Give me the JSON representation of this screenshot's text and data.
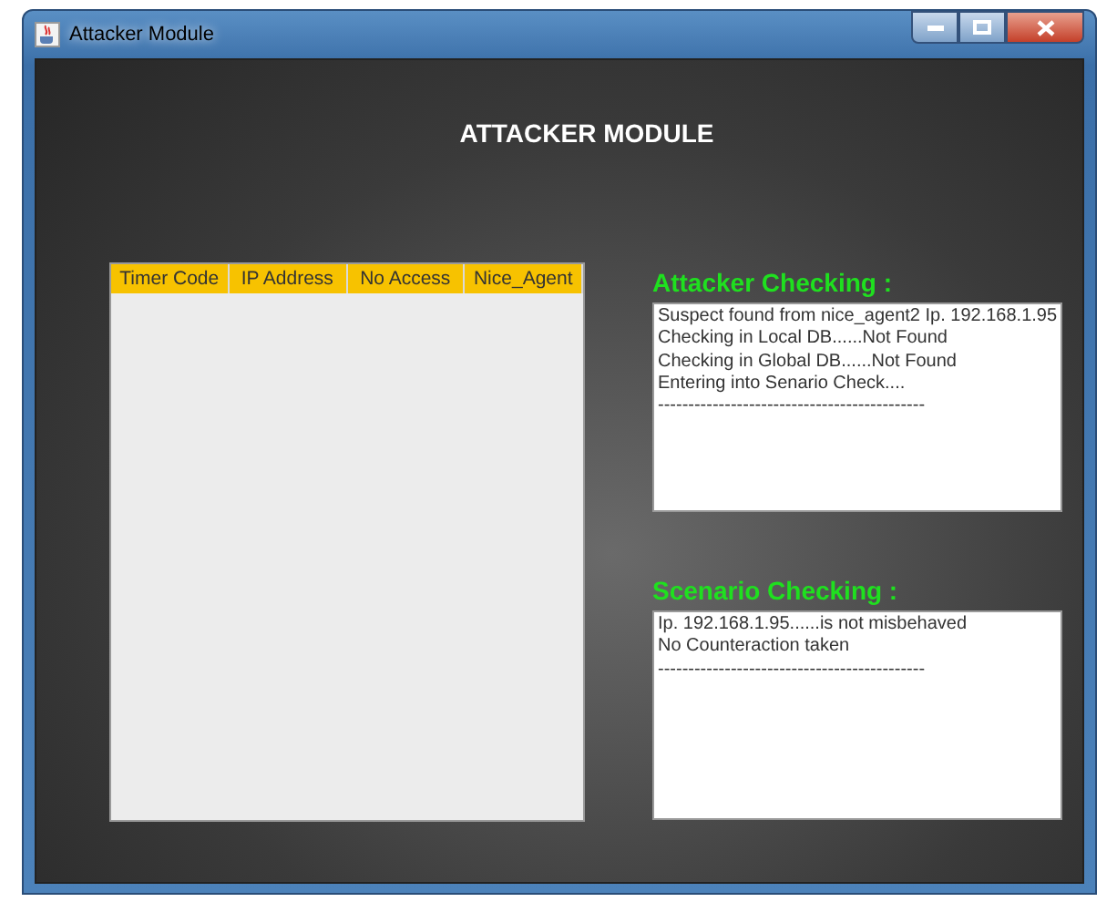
{
  "window": {
    "title": "Attacker Module"
  },
  "heading": "ATTACKER MODULE",
  "table": {
    "columns": [
      "Timer Code",
      "IP Address",
      "No Access",
      "Nice_Agent"
    ]
  },
  "attacker_checking": {
    "label": "Attacker Checking :",
    "lines": [
      "Suspect found from nice_agent2 Ip. 192.168.1.95",
      "Checking in Local DB......Not Found",
      "Checking in Global  DB......Not Found",
      "Entering into Senario Check....",
      "--------------------------------------------"
    ]
  },
  "scenario_checking": {
    "label": "Scenario Checking :",
    "lines": [
      "Ip. 192.168.1.95......is not misbehaved",
      "No Counteraction taken",
      "--------------------------------------------"
    ]
  }
}
